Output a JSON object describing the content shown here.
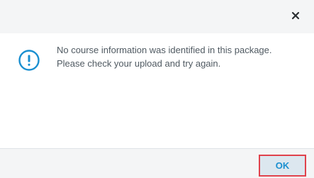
{
  "dialog": {
    "close_icon": "close-icon",
    "info_icon": "exclamation-circle-icon",
    "accent_color": "#1a8fd0",
    "message_lines": [
      "No course information was identified in this package.",
      "Please check your upload and try again."
    ],
    "ok_label": "OK",
    "highlight_color": "#e0424c"
  }
}
